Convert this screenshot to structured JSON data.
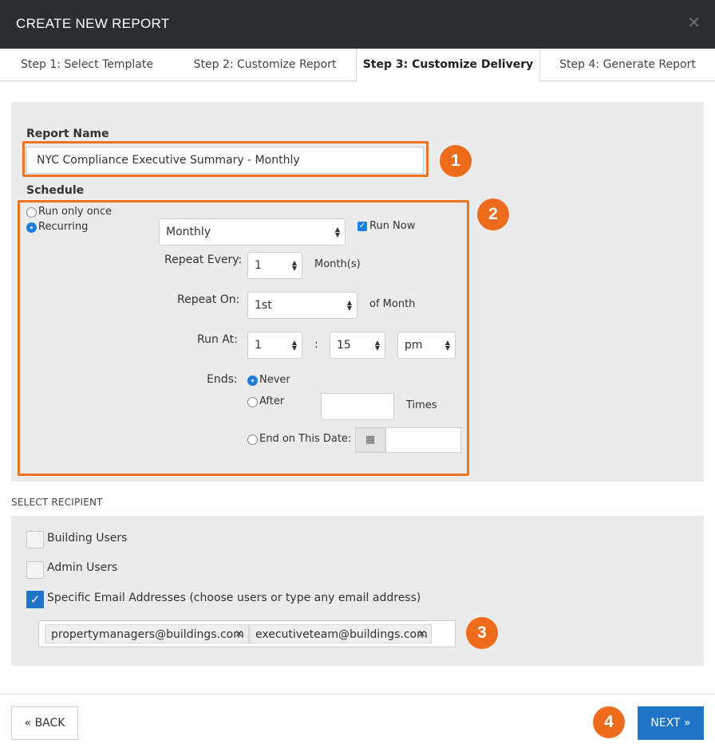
{
  "header": {
    "title": "CREATE NEW REPORT",
    "close_icon": "close-icon"
  },
  "tabs": [
    {
      "label": "Step 1: Select Template"
    },
    {
      "label": "Step 2: Customize Report"
    },
    {
      "label": "Step 3: Customize Delivery",
      "active": true
    },
    {
      "label": "Step 4: Generate Report"
    }
  ],
  "report": {
    "name_label": "Report Name",
    "name_value": "NYC Compliance Executive Summary - Monthly"
  },
  "schedule": {
    "label": "Schedule",
    "run_once_label": "Run only once",
    "recurring_label": "Recurring",
    "mode": "recurring",
    "frequency": "Monthly",
    "run_now_label": "Run Now",
    "run_now_checked": true,
    "repeat_every_label": "Repeat Every:",
    "repeat_every_value": "1",
    "repeat_every_unit": "Month(s)",
    "repeat_on_label": "Repeat On:",
    "repeat_on_value": "1st",
    "repeat_on_suffix": "of Month",
    "run_at_label": "Run At:",
    "run_at_hour": "1",
    "run_at_sep": ":",
    "run_at_minute": "15",
    "run_at_ampm": "pm",
    "ends_label": "Ends:",
    "ends_never_label": "Never",
    "ends_after_label": "After",
    "ends_after_value": "",
    "ends_times_label": "Times",
    "ends_on_date_label": "End on This Date:",
    "ends_on_date_value": "",
    "ends_selected": "never"
  },
  "recipients": {
    "section_label": "SELECT RECIPIENT",
    "options": [
      {
        "label": "Building Users",
        "checked": false
      },
      {
        "label": "Admin Users",
        "checked": false
      },
      {
        "label": "Specific Email Addresses (choose users or type any email address)",
        "checked": true
      }
    ],
    "emails": [
      {
        "address": "propertymanagers@buildings.com",
        "remove": "×"
      },
      {
        "address": "executiveteam@buildings.com",
        "remove": "×"
      }
    ]
  },
  "callouts": [
    "1",
    "2",
    "3",
    "4"
  ],
  "footer": {
    "back_label": "BACK",
    "next_label": "NEXT"
  },
  "colors": {
    "accent": "#1f74c7",
    "highlight": "#ee7421",
    "header_bg": "#2b2e31"
  }
}
